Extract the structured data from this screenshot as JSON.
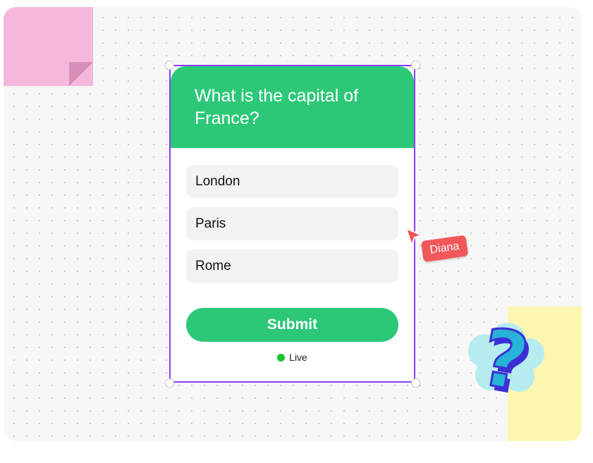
{
  "quiz": {
    "question": "What is the capital of France?",
    "options": [
      "London",
      "Paris",
      "Rome"
    ],
    "submit_label": "Submit",
    "status_label": "Live"
  },
  "collaborator": {
    "name": "Diana",
    "tag_color": "#f2575a"
  },
  "colors": {
    "accent_green": "#2cc878",
    "selection_purple": "#8b3dff",
    "sticky_pink": "#f4b8dc",
    "sticky_yellow": "#fdf6b1",
    "live_dot": "#16c32b"
  },
  "icons": {
    "sticker": "question-mark-icon",
    "pointer": "cursor-arrow-icon",
    "status": "live-dot-icon"
  }
}
